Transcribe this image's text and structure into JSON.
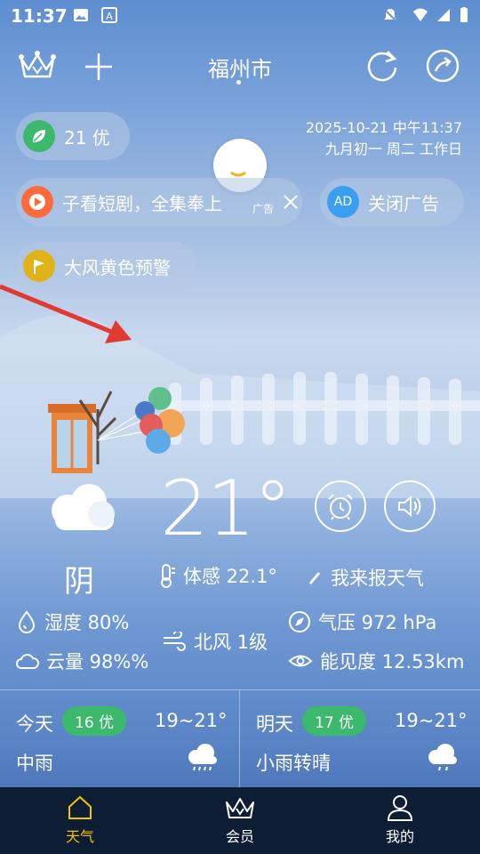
{
  "status_bar": {
    "time": "11:37"
  },
  "header": {
    "city": "福州市"
  },
  "aqi_pill": {
    "value": "21 优"
  },
  "date": {
    "line1": "2025-10-21 中午11:37",
    "line2": "九月初一 周二 工作日"
  },
  "ad": {
    "text": "子看短剧，全集奉上",
    "tag": "广告",
    "close_ad_label": "关闭广告",
    "ad_badge": "AD"
  },
  "alert": {
    "text": "大风黄色预警"
  },
  "current": {
    "temperature": "21°",
    "condition": "阴",
    "feels_like": "体感 22.1°",
    "report": "我来报天气",
    "humidity": "湿度 80%",
    "wind": "北风 1级",
    "pressure": "气压 972 hPa",
    "cloud": "云量 98%%",
    "visibility": "能见度 12.53km"
  },
  "forecast": [
    {
      "day": "今天",
      "aqi": "16 优",
      "range": "19~21°",
      "desc": "中雨"
    },
    {
      "day": "明天",
      "aqi": "17 优",
      "range": "19~21°",
      "desc": "小雨转晴"
    }
  ],
  "nav": [
    {
      "label": "天气",
      "active": true
    },
    {
      "label": "会员",
      "active": false
    },
    {
      "label": "我的",
      "active": false
    }
  ],
  "colors": {
    "accent": "#f5c400",
    "aqi_green": "#3cb96d",
    "nav_bg": "#0d1d33",
    "ad_blue": "#3a9ff0"
  }
}
